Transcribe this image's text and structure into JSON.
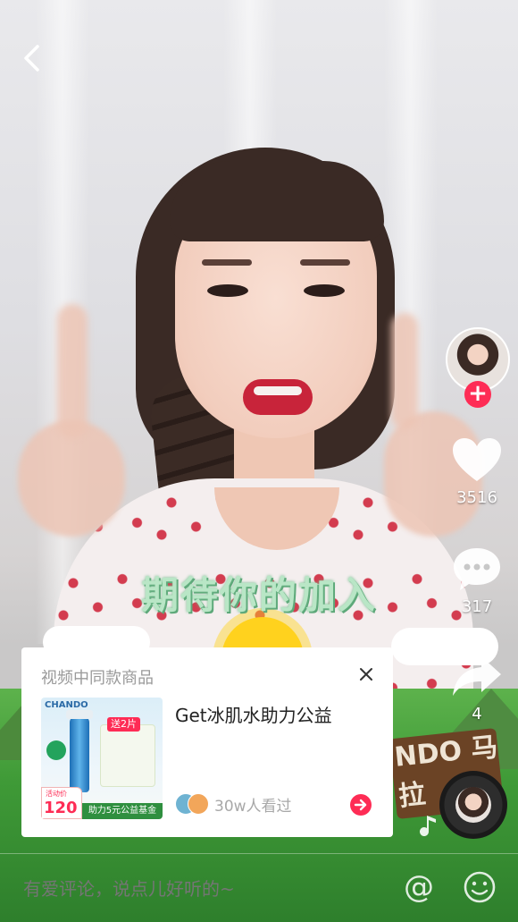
{
  "video": {
    "caption": "期待你的加入",
    "sign_text": "NDO 马拉"
  },
  "nav": {
    "back_icon": "chevron-left-icon"
  },
  "sidebar": {
    "avatar_icon": "creator-avatar",
    "follow_symbol": "+",
    "likes": {
      "icon": "heart-icon",
      "count": "3516"
    },
    "comments": {
      "icon": "comment-bubble-icon",
      "count": "317"
    },
    "shares": {
      "icon": "share-arrow-icon",
      "count": "4"
    },
    "music_disc_icon": "music-disc-icon"
  },
  "product_card": {
    "title": "视频中同款商品",
    "close_icon": "close-icon",
    "product_name": "Get冰肌水助力公益",
    "viewers_text": "30w人看过",
    "go_icon": "arrow-right-icon",
    "product_image": {
      "brand": "CHANDO",
      "tag": "送2片",
      "price": "120",
      "price_label": "活动价",
      "banner": "助力5元公益基金"
    }
  },
  "comment_bar": {
    "placeholder": "有爱评论，说点儿好听的~",
    "at_symbol": "@",
    "emoji_icon": "emoji-smile-icon"
  },
  "colors": {
    "accent": "#fe2c55",
    "caption": "#b9e6c6"
  }
}
